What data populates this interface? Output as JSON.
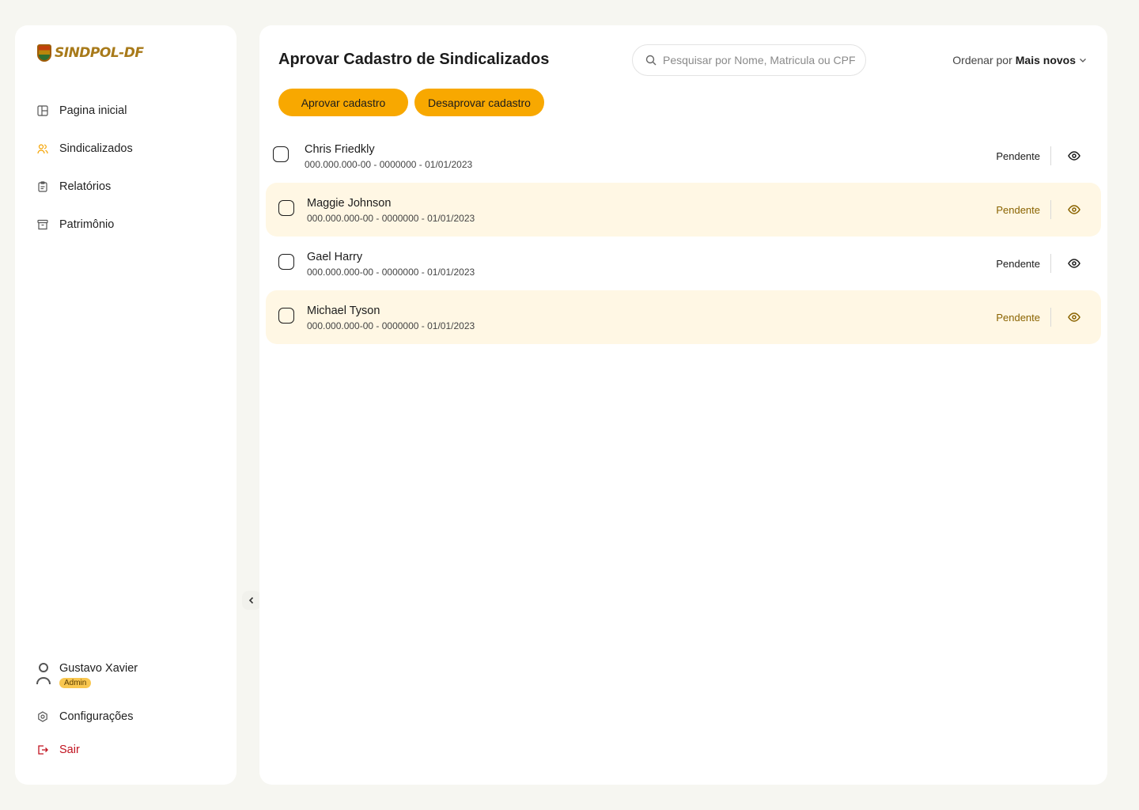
{
  "brand": {
    "name": "SINDPOL-DF"
  },
  "sidebar": {
    "items": [
      {
        "label": "Pagina inicial",
        "icon": "layout-icon",
        "active": false
      },
      {
        "label": "Sindicalizados",
        "icon": "users-icon",
        "active": true
      },
      {
        "label": "Relatórios",
        "icon": "clipboard-icon",
        "active": false
      },
      {
        "label": "Patrimônio",
        "icon": "archive-icon",
        "active": false
      }
    ],
    "user": {
      "name": "Gustavo Xavier",
      "role": "Admin"
    },
    "settings_label": "Configurações",
    "logout_label": "Sair"
  },
  "main": {
    "title": "Aprovar Cadastro de Sindicalizados",
    "search_placeholder": "Pesquisar por Nome, Matricula ou CPF",
    "sort_prefix": "Ordenar por",
    "sort_value": "Mais novos",
    "approve_label": "Aprovar cadastro",
    "reject_label": "Desaprovar cadastro",
    "rows": [
      {
        "name": "Chris Friedkly",
        "meta": "000.000.000-00  -  0000000 - 01/01/2023",
        "status": "Pendente"
      },
      {
        "name": "Maggie Johnson",
        "meta": "000.000.000-00  -  0000000 - 01/01/2023",
        "status": "Pendente"
      },
      {
        "name": "Gael Harry",
        "meta": "000.000.000-00  -  0000000 - 01/01/2023",
        "status": "Pendente"
      },
      {
        "name": "Michael Tyson",
        "meta": "000.000.000-00  -  0000000 - 01/01/2023",
        "status": "Pendente"
      }
    ]
  },
  "colors": {
    "accent": "#f8a800",
    "highlight_row": "#fff7e4",
    "danger": "#c1121f"
  }
}
